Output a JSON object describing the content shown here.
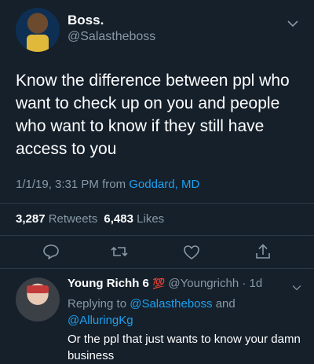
{
  "tweet": {
    "author_name": "Boss.",
    "author_handle": "@Salastheboss",
    "text": "Know the difference between ppl who want to check up on you and people who want to know if they still have access to you",
    "timestamp": "1/1/19, 3:31 PM from",
    "location": "Goddard, MD",
    "retweets_count": "3,287",
    "retweets_label": "Retweets",
    "likes_count": "6,483",
    "likes_label": "Likes",
    "actions": [
      "reply-icon",
      "retweet-icon",
      "like-icon",
      "share-icon"
    ]
  },
  "reply": {
    "author_name": "Young Richh 6",
    "author_emoji": "💯",
    "author_handle": "@Youngrichh",
    "time": "· 1d",
    "replying_prefix": "Replying to",
    "replying_to_1": "@Salastheboss",
    "replying_and": "and",
    "replying_to_2": "@AlluringKg",
    "text": "Or the ppl that just wants to know your damn business"
  },
  "colors": {
    "background": "#15202b",
    "muted": "#8899a6",
    "link": "#1da1f2",
    "divider": "#2b3a48"
  }
}
